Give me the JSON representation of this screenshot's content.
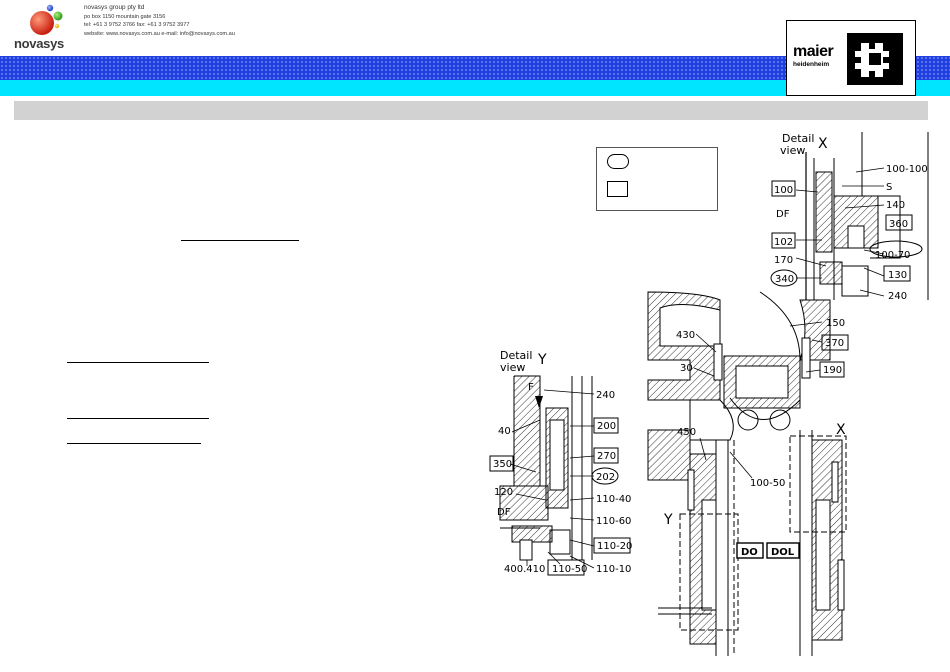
{
  "header": {
    "company": "novasys group pty ltd",
    "address": "po box 1150 mountain gate 3156",
    "phone": "tel: +61 3 9752 3766  fax: +61 3 9752 3977",
    "web": "website: www.novasys.com.au  e-mail: info@novasys.com.au",
    "logo_text": "novasys",
    "partner_line1": "maier",
    "partner_line2": "heidenheim"
  },
  "colors": {
    "band_blue": "#1f3fe0",
    "band_cyan": "#00e5ff",
    "grey_bar": "#d2d2d2"
  },
  "drawing": {
    "detail_x": {
      "title_line1": "Detail",
      "title_line2": "view",
      "letter": "X"
    },
    "detail_y": {
      "title_line1": "Detail",
      "title_line2": "view",
      "letter": "Y"
    },
    "labels_x": {
      "l100_100": "100-100",
      "lS": "S",
      "l100": "100",
      "l140": "140",
      "lDF": "DF",
      "l360": "360",
      "l102": "102",
      "l100_70": "100-70",
      "l170": "170",
      "l130": "130",
      "l340": "340",
      "l240": "240"
    },
    "labels_main": {
      "l150": "150",
      "l430": "430",
      "l370": "370",
      "l30": "30",
      "l190": "190",
      "l450": "450",
      "l100_50": "100-50",
      "lX": "X",
      "lY": "Y",
      "lDO": "DO",
      "lDOL": "DOL"
    },
    "labels_y": {
      "lF": "F",
      "l240": "240",
      "l40": "40",
      "l200": "200",
      "l270": "270",
      "l350": "350",
      "l202": "202",
      "l120": "120",
      "l110_40": "110-40",
      "lDF": "DF",
      "l110_60": "110-60",
      "l110_20": "110-20",
      "l400_410": "400.410",
      "l110_50": "110-50",
      "l110_10": "110-10"
    }
  }
}
